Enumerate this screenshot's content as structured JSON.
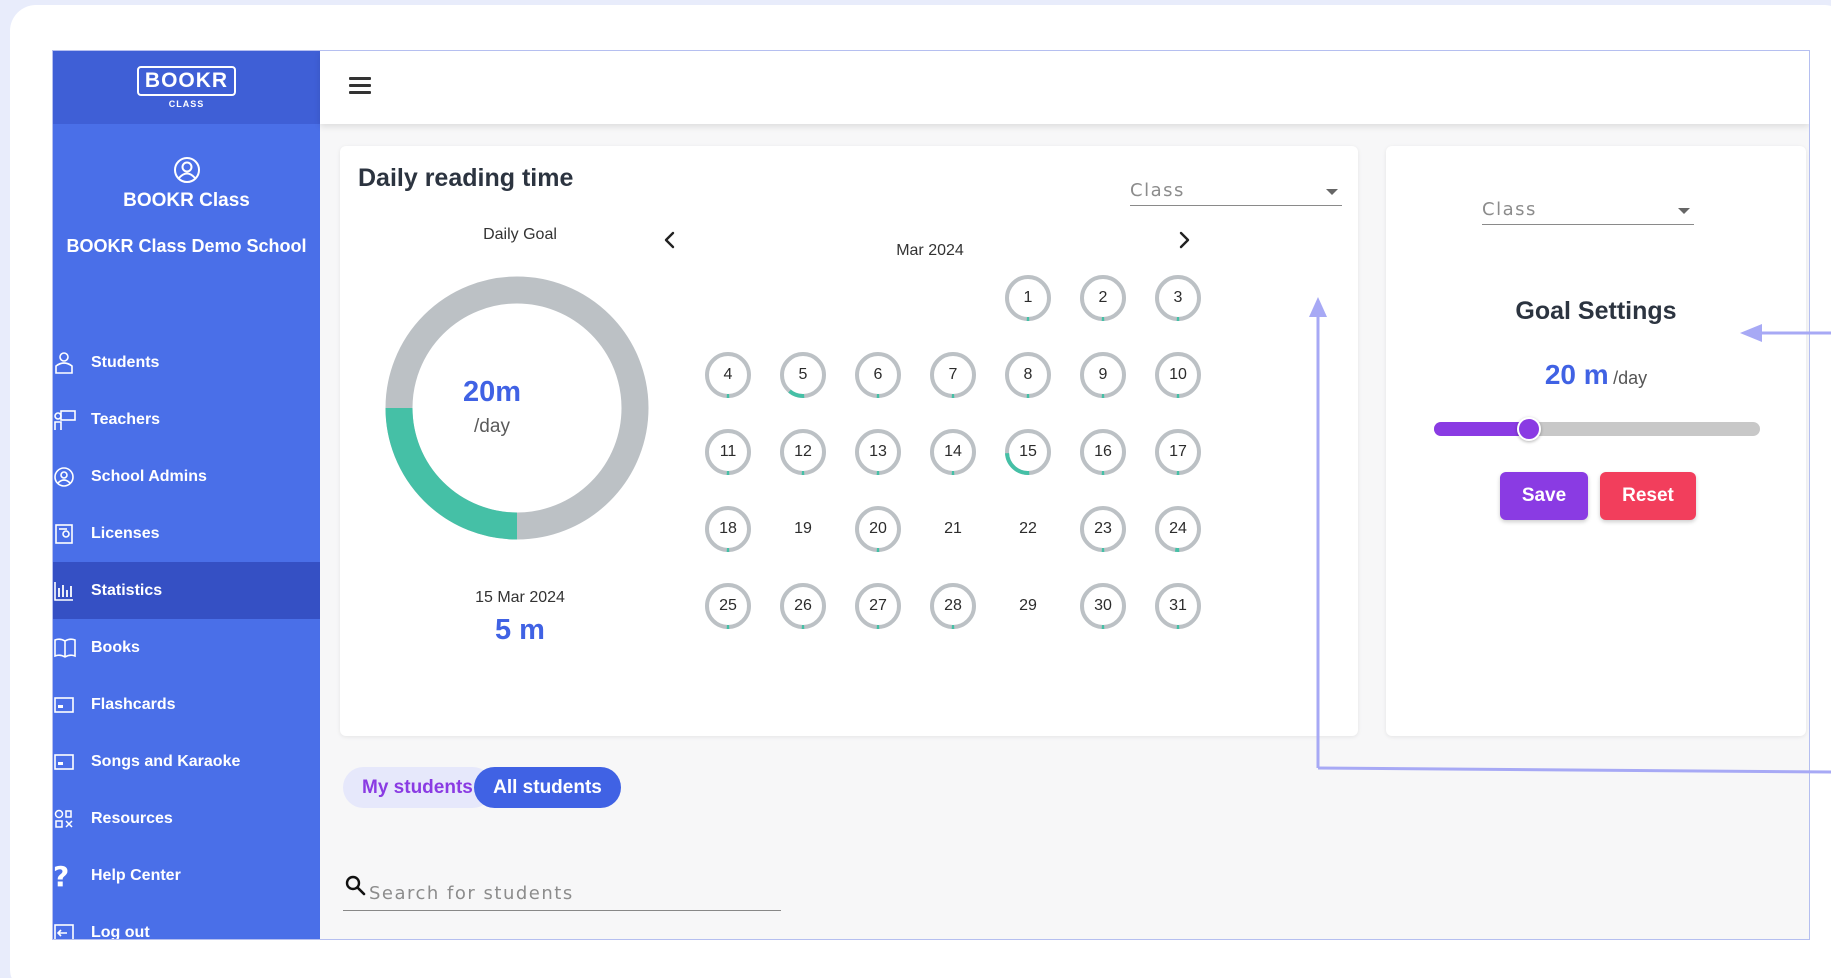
{
  "sidebar": {
    "logo": "BOOKR",
    "logo_sub": "CLASS",
    "profile_name": "BOOKR Class",
    "school_name": "BOOKR Class Demo School",
    "items": [
      {
        "label": "Students",
        "icon": "student-icon"
      },
      {
        "label": "Teachers",
        "icon": "teacher-icon"
      },
      {
        "label": "School Admins",
        "icon": "admin-icon"
      },
      {
        "label": "Licenses",
        "icon": "license-icon"
      },
      {
        "label": "Statistics",
        "icon": "bar-chart-icon",
        "active": true
      },
      {
        "label": "Books",
        "icon": "book-icon"
      },
      {
        "label": "Flashcards",
        "icon": "flashcard-icon"
      },
      {
        "label": "Songs and Karaoke",
        "icon": "song-icon"
      },
      {
        "label": "Resources",
        "icon": "resources-icon"
      },
      {
        "label": "Help Center",
        "icon": "question-icon"
      },
      {
        "label": "Log out",
        "icon": "logout-icon"
      }
    ]
  },
  "reading": {
    "title": "Daily reading time",
    "class_placeholder": "Class",
    "daily_goal_label": "Daily Goal",
    "goal_value": "20m",
    "goal_unit": "/day",
    "progress_fraction": 0.25,
    "selected_date": "15 Mar 2024",
    "selected_minutes": "5 m",
    "month": "Mar 2024",
    "days": [
      {
        "d": "1",
        "ring": true,
        "progress": 0
      },
      {
        "d": "2",
        "ring": true,
        "progress": 0
      },
      {
        "d": "3",
        "ring": true,
        "progress": 0
      },
      {
        "d": "4",
        "ring": true,
        "progress": 0
      },
      {
        "d": "5",
        "ring": true,
        "progress": 0.12
      },
      {
        "d": "6",
        "ring": true,
        "progress": 0
      },
      {
        "d": "7",
        "ring": true,
        "progress": 0
      },
      {
        "d": "8",
        "ring": true,
        "progress": 0
      },
      {
        "d": "9",
        "ring": true,
        "progress": 0
      },
      {
        "d": "10",
        "ring": true,
        "progress": 0
      },
      {
        "d": "11",
        "ring": true,
        "progress": 0
      },
      {
        "d": "12",
        "ring": true,
        "progress": 0
      },
      {
        "d": "13",
        "ring": true,
        "progress": 0
      },
      {
        "d": "14",
        "ring": true,
        "progress": 0
      },
      {
        "d": "15",
        "ring": true,
        "progress": 0.25
      },
      {
        "d": "16",
        "ring": true,
        "progress": 0
      },
      {
        "d": "17",
        "ring": true,
        "progress": 0
      },
      {
        "d": "18",
        "ring": true,
        "progress": 0
      },
      {
        "d": "19",
        "ring": false,
        "progress": 0
      },
      {
        "d": "20",
        "ring": true,
        "progress": 0
      },
      {
        "d": "21",
        "ring": false,
        "progress": 0
      },
      {
        "d": "22",
        "ring": false,
        "progress": 0
      },
      {
        "d": "23",
        "ring": true,
        "progress": 0
      },
      {
        "d": "24",
        "ring": true,
        "progress": 0.03
      },
      {
        "d": "25",
        "ring": true,
        "progress": 0
      },
      {
        "d": "26",
        "ring": true,
        "progress": 0
      },
      {
        "d": "27",
        "ring": true,
        "progress": 0
      },
      {
        "d": "28",
        "ring": true,
        "progress": 0
      },
      {
        "d": "29",
        "ring": false,
        "progress": 0
      },
      {
        "d": "30",
        "ring": true,
        "progress": 0
      },
      {
        "d": "31",
        "ring": true,
        "progress": 0
      }
    ]
  },
  "goal": {
    "class_placeholder": "Class",
    "title": "Goal Settings",
    "value": "20 m",
    "unit": "/day",
    "slider_fraction": 0.29,
    "save_label": "Save",
    "reset_label": "Reset"
  },
  "tabs": {
    "my_students": "My students",
    "all_students": "All students"
  },
  "search": {
    "placeholder": "Search for students"
  },
  "colors": {
    "sidebar": "#4a6fe8",
    "accent_blue": "#4062e4",
    "purple": "#8a3be3",
    "reset_red": "#f23e5c",
    "progress_green": "#45c0a6",
    "ring_grey": "#bcc1c5"
  }
}
